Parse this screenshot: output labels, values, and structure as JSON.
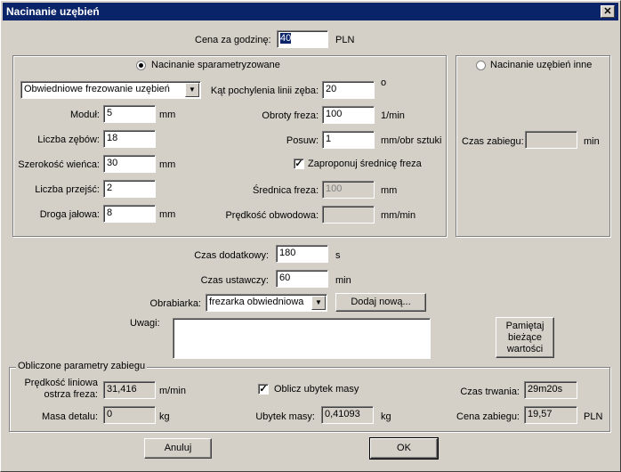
{
  "window": {
    "title": "Nacinanie uzębień",
    "close_glyph": "✕"
  },
  "top": {
    "cena_label": "Cena za godzinę:",
    "cena_value": "40",
    "cena_unit": "PLN"
  },
  "param_group": {
    "radio_label": "Nacinanie sparametryzowane",
    "method_value": "Obwiedniowe frezowanie uzębień",
    "modul_label": "Moduł:",
    "modul_value": "5",
    "modul_unit": "mm",
    "zeby_label": "Liczba zębów:",
    "zeby_value": "18",
    "szer_label": "Szerokość wieńca:",
    "szer_value": "30",
    "szer_unit": "mm",
    "przejscia_label": "Liczba przejść:",
    "przejscia_value": "2",
    "droga_label": "Droga jałowa:",
    "droga_value": "8",
    "droga_unit": "mm",
    "kat_label": "Kąt pochylenia linii zęba:",
    "kat_value": "20",
    "kat_unit": "o",
    "obroty_label": "Obroty freza:",
    "obroty_value": "100",
    "obroty_unit": "1/min",
    "posuw_label": "Posuw:",
    "posuw_value": "1",
    "posuw_unit": "mm/obr sztuki",
    "srednica_check_label": "Zaproponuj średnicę freza",
    "srednica_label": "Średnica freza:",
    "srednica_value": "100",
    "srednica_unit": "mm",
    "predkosc_label": "Prędkość obwodowa:",
    "predkosc_value": "",
    "predkosc_unit": "mm/min"
  },
  "other_group": {
    "radio_label": "Nacinanie uzębień inne",
    "czas_label": "Czas zabiegu:",
    "czas_value": "",
    "czas_unit": "min"
  },
  "middle": {
    "dodatkowy_label": "Czas dodatkowy:",
    "dodatkowy_value": "180",
    "dodatkowy_unit": "s",
    "ustawczy_label": "Czas ustawczy:",
    "ustawczy_value": "60",
    "ustawczy_unit": "min",
    "obrabiarka_label": "Obrabiarka:",
    "obrabiarka_value": "frezarka obwiedniowa",
    "dodaj_label": "Dodaj nową...",
    "uwagi_label": "Uwagi:",
    "uwagi_value": "",
    "pamietaj_line1": "Pamiętaj",
    "pamietaj_line2": "bieżące",
    "pamietaj_line3": "wartości"
  },
  "results": {
    "title": "Obliczone parametry zabiegu",
    "predkosc_line1": "Prędkość liniowa",
    "predkosc_line2": "ostrza freza:",
    "predkosc_value": "31,416",
    "predkosc_unit": "m/min",
    "masa_label": "Masa detalu:",
    "masa_value": "0",
    "masa_unit": "kg",
    "oblicz_label": "Oblicz ubytek masy",
    "ubytek_label": "Ubytek masy:",
    "ubytek_value": "0,41093",
    "ubytek_unit": "kg",
    "czas_trwania_label": "Czas trwania:",
    "czas_trwania_value": "29m20s",
    "cena_label": "Cena zabiegu:",
    "cena_value": "19,57",
    "cena_unit": "PLN"
  },
  "buttons": {
    "cancel": "Anuluj",
    "ok": "OK"
  }
}
